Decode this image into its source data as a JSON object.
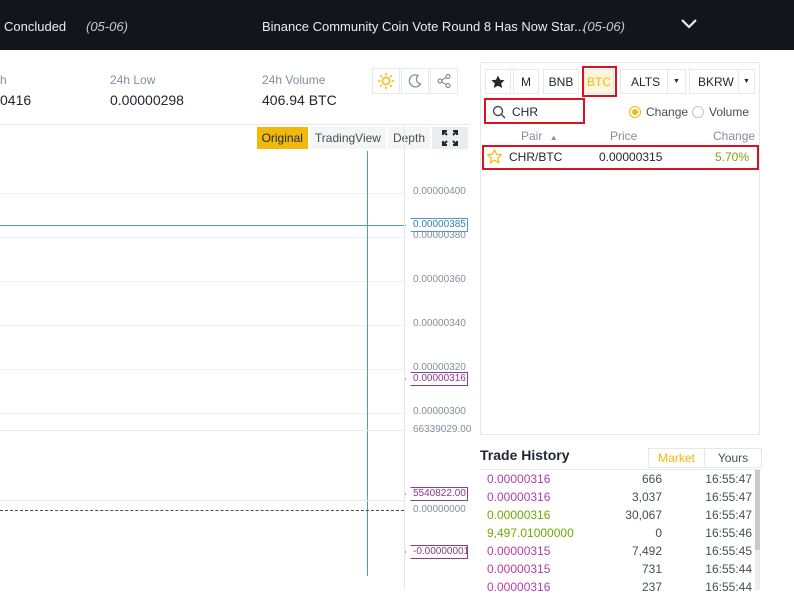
{
  "announcements": [
    {
      "title": "Concluded",
      "date": "(05-06)"
    },
    {
      "title": "Binance Community Coin Vote Round 8 Has Now Star...",
      "date": "(05-06)"
    }
  ],
  "stats": [
    {
      "label": "h",
      "value": "0416"
    },
    {
      "label": "24h Low",
      "value": "0.00000298"
    },
    {
      "label": "24h Volume",
      "value": "406.94 BTC"
    }
  ],
  "chart": {
    "tabs": [
      "Original",
      "TradingView",
      "Depth"
    ],
    "active_tab": "Original",
    "price_ticks": [
      "0.00000400",
      "0.00000380",
      "0.00000360",
      "0.00000340",
      "0.00000320",
      "0.00000300"
    ],
    "price_tag_blue": "0.00000385",
    "price_tag_purple": "0.00000316",
    "vol_top_label": "66339029.00",
    "vol_tag": "5540822.00",
    "macd_zero": "0.00000000",
    "macd_tag": "-0.00000001"
  },
  "market": {
    "tabs": {
      "favorites_icon": "star-icon",
      "margin": "M",
      "bnb": "BNB",
      "btc": "BTC",
      "alts": "ALTS",
      "bkrw": "BKRW"
    },
    "search_value": "CHR",
    "radio": {
      "change": "Change",
      "volume": "Volume",
      "selected": "Change"
    },
    "columns": {
      "pair": "Pair",
      "price": "Price",
      "change": "Change"
    },
    "rows": [
      {
        "pair": "CHR/BTC",
        "price": "0.00000315",
        "change": "5.70%"
      }
    ],
    "colors": {
      "accent": "#f0b90b",
      "up": "#70a800",
      "highlight": "#d9121f"
    }
  },
  "trade_history": {
    "title": "Trade History",
    "tabs": [
      "Market",
      "Yours"
    ],
    "selected_tab": "Market",
    "rows": [
      {
        "price": "0.00000316",
        "amount": "666",
        "time": "16:55:47",
        "side": "sell"
      },
      {
        "price": "0.00000316",
        "amount": "3,037",
        "time": "16:55:47",
        "side": "sell"
      },
      {
        "price": "0.00000316",
        "amount": "30,067",
        "time": "16:55:47",
        "side": "buy"
      },
      {
        "price": "9,497.01000000",
        "amount": "0",
        "time": "16:55:46",
        "side": "buy"
      },
      {
        "price": "0.00000315",
        "amount": "7,492",
        "time": "16:55:45",
        "side": "sell"
      },
      {
        "price": "0.00000315",
        "amount": "731",
        "time": "16:55:44",
        "side": "sell"
      },
      {
        "price": "0.00000316",
        "amount": "237",
        "time": "16:55:44",
        "side": "sell"
      }
    ]
  }
}
